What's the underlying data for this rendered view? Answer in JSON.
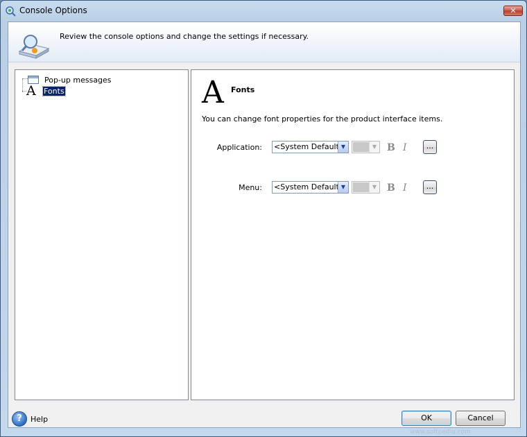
{
  "window": {
    "title": "Console Options",
    "close_label": "✕"
  },
  "header": {
    "text": "Review the console options and change the settings if necessary."
  },
  "tree": {
    "items": [
      {
        "label": "Pop-up messages",
        "icon": "popup-window-icon",
        "selected": false
      },
      {
        "label": "Fonts",
        "icon": "font-a-icon",
        "selected": true
      }
    ]
  },
  "content": {
    "icon_glyph": "A",
    "title": "Fonts",
    "description": "You can change font properties for the product interface items.",
    "rows": [
      {
        "label": "Application:",
        "font": "<System Default>",
        "size": "",
        "bold": "B",
        "italic": "I",
        "more": "..."
      },
      {
        "label": "Menu:",
        "font": "<System Default>",
        "size": "",
        "bold": "B",
        "italic": "I",
        "more": "..."
      }
    ]
  },
  "footer": {
    "help_label": "Help",
    "ok_label": "OK",
    "cancel_label": "Cancel",
    "watermark": "www.softpedia.com"
  },
  "colors": {
    "selection": "#0a246a",
    "titlebar": "#c9dcee",
    "close_button": "#c9584a"
  }
}
